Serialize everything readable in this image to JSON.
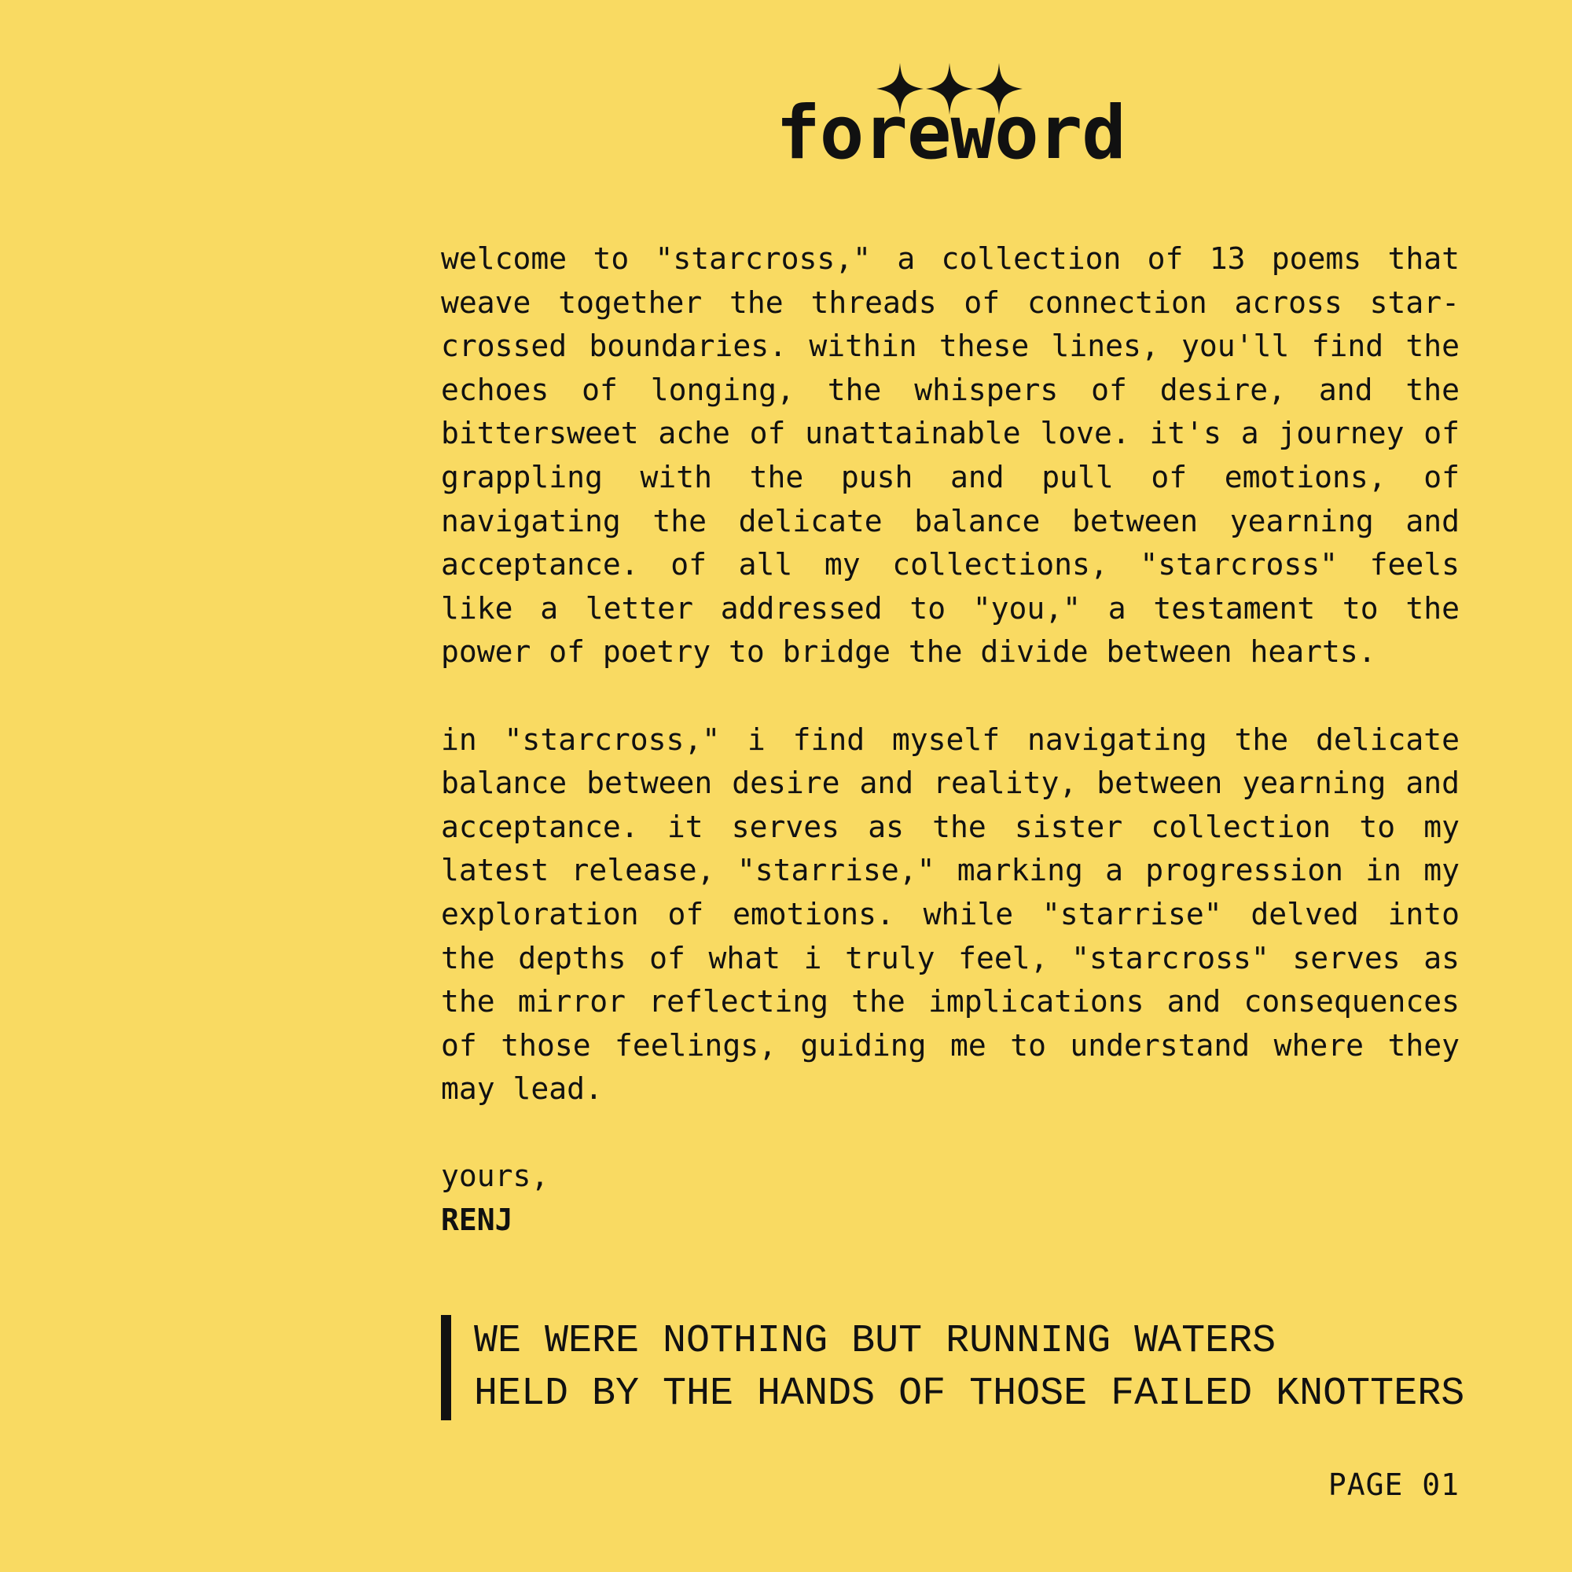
{
  "colors": {
    "background": "#F9DA62",
    "text": "#111111"
  },
  "header": {
    "ornament_icon": "three-four-point-stars-icon",
    "title": "foreword"
  },
  "body": {
    "paragraphs": [
      "welcome to \"starcross,\" a collection of 13 poems that weave together the threads of connection across star-crossed boundaries. within these lines, you'll find the echoes of longing, the whispers of desire, and the bittersweet ache of unattainable love. it's a journey of grappling with the push and pull of emotions, of navigating the delicate balance between yearning and acceptance. of all my collections, \"starcross\" feels like a letter addressed to \"you,\" a testament to the power of poetry to bridge the divide between hearts.",
      "in \"starcross,\" i find myself navigating the delicate balance between desire and reality, between yearning and acceptance. it serves as the sister collection to my latest release, \"starrise,\" marking a progression in my exploration of emotions. while \"starrise\" delved into the depths of what i truly feel, \"starcross\" serves as the mirror reflecting the implications and consequences of those feelings, guiding me to understand where they may lead."
    ],
    "signoff": "yours,",
    "author": "RENJ"
  },
  "quote": {
    "lines": [
      "WE WERE NOTHING BUT RUNNING WATERS",
      "HELD BY THE HANDS OF THOSE FAILED KNOTTERS"
    ]
  },
  "footer": {
    "page_label": "PAGE 01"
  }
}
